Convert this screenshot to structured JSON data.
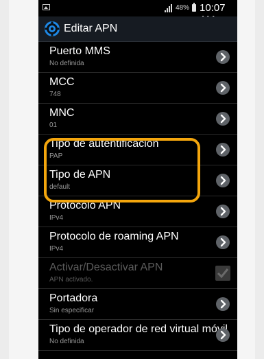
{
  "status_bar": {
    "battery_percent": "48%",
    "time": "10:07 AM"
  },
  "action_bar": {
    "title": "Editar APN",
    "icon": "settings-gear-icon"
  },
  "settings": [
    {
      "label": "Puerto MMS",
      "value": "No definida",
      "control": "chevron"
    },
    {
      "label": "MCC",
      "value": "748",
      "control": "chevron"
    },
    {
      "label": "MNC",
      "value": "01",
      "control": "chevron"
    },
    {
      "label": "Tipo de autentificación",
      "value": "PAP",
      "control": "chevron"
    },
    {
      "label": "Tipo de APN",
      "value": "default",
      "control": "chevron"
    },
    {
      "label": "Protocolo APN",
      "value": "IPv4",
      "control": "chevron"
    },
    {
      "label": "Protocolo de roaming APN",
      "value": "IPv4",
      "control": "chevron"
    },
    {
      "label": "Activar/Desactivar APN",
      "value": "APN activado.",
      "control": "checkbox",
      "disabled": true,
      "checked": true
    },
    {
      "label": "Portadora",
      "value": "Sin especificar",
      "control": "chevron"
    },
    {
      "label": "Tipo de operador de red virtual móvil",
      "value": "No definida",
      "control": "chevron"
    }
  ],
  "colors": {
    "highlight": "#f4a60d",
    "background": "#000000",
    "accent": "#1e88e5"
  }
}
